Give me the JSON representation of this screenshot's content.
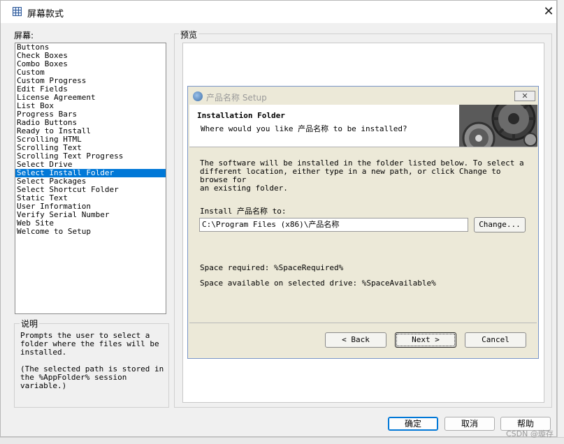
{
  "window": {
    "title": "屏幕款式",
    "close_glyph": "✕"
  },
  "labels": {
    "screen": "屏幕:",
    "description": "说明",
    "preview": "预览"
  },
  "screens": [
    "Buttons",
    "Check Boxes",
    "Combo Boxes",
    "Custom",
    "Custom Progress",
    "Edit Fields",
    "License Agreement",
    "List Box",
    "Progress Bars",
    "Radio Buttons",
    "Ready to Install",
    "Scrolling HTML",
    "Scrolling Text",
    "Scrolling Text Progress",
    "Select Drive",
    "Select Install Folder",
    "Select Packages",
    "Select Shortcut Folder",
    "Static Text",
    "User Information",
    "Verify Serial Number",
    "Web Site",
    "Welcome to Setup"
  ],
  "selected_screen": "Select Install Folder",
  "description_text": "Prompts the user to select a\nfolder where the files will be\ninstalled.\n\n(The selected path is stored in\nthe %AppFolder% session\nvariable.)",
  "setup": {
    "title": "产品名称 Setup",
    "close_glyph": "✕",
    "header_title": "Installation Folder",
    "header_subtitle": "Where would you like 产品名称 to be installed?",
    "body_text": "The software will be installed in the folder listed below. To select a\ndifferent location, either type in a new path, or click Change to browse for\nan existing folder.",
    "install_label": "Install 产品名称 to:",
    "path_value": "C:\\Program Files (x86)\\产品名称",
    "change_button": "Change...",
    "space_required": "Space required: %SpaceRequired%",
    "space_available": "Space available on selected drive: %SpaceAvailable%",
    "back_button": "< Back",
    "next_button": "Next >",
    "cancel_button": "Cancel"
  },
  "buttons": {
    "ok": "确定",
    "cancel": "取消",
    "help": "帮助"
  },
  "watermark": "CSDN @璇存",
  "colors": {
    "selection": "#0078d7",
    "dialog_bg": "#f0f0f0",
    "setup_bg": "#ece9d8"
  }
}
